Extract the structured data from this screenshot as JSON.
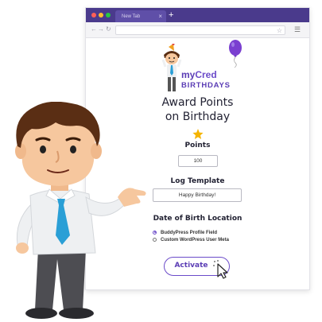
{
  "browser": {
    "tab_title": "New Tab",
    "tab_close": "×",
    "new_tab": "+",
    "nav_back": "←",
    "nav_forward": "→",
    "nav_reload": "↻",
    "star": "☆",
    "menu": "☰"
  },
  "logo": {
    "my": "my",
    "cred": "Cred",
    "sub": "BIRTHDAYS"
  },
  "main": {
    "heading_line1": "Award Points",
    "heading_line2": "on Birthday",
    "points_label": "Points",
    "points_value": "100",
    "log_label": "Log Template",
    "log_value": "Happy Birthday!",
    "dob_label": "Date of Birth Location",
    "dob_options": [
      {
        "label": "BuddyPress Profile Field",
        "selected": true
      },
      {
        "label": "Custom WordPress User Meta",
        "selected": false
      }
    ],
    "activate_label": "Activate"
  },
  "colors": {
    "tab_bar": "#4a3a8c",
    "accent": "#6b4bc9",
    "balloon": "#7a3fd0",
    "trophy": "#f5b400",
    "shirt": "#eef0f2",
    "tie": "#2a9fd6",
    "hair": "#5a2e14",
    "skin": "#f6c79e"
  },
  "icons": [
    "trophy-icon",
    "balloon-icon",
    "cursor-icon",
    "radio-icon"
  ]
}
